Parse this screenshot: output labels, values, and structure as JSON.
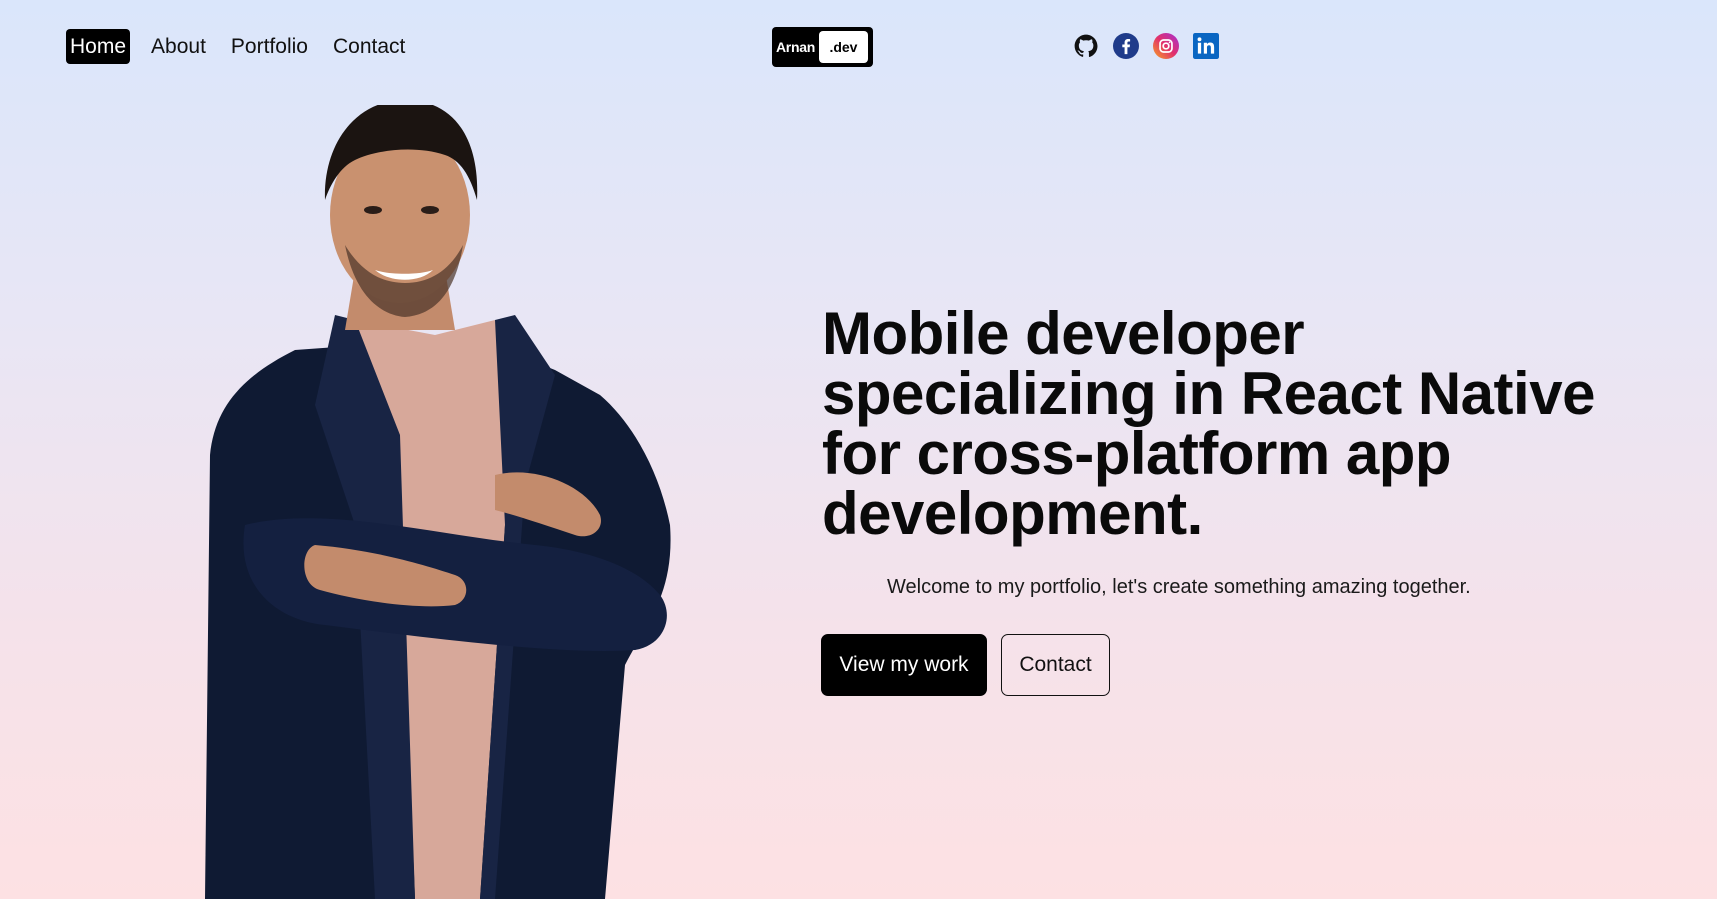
{
  "nav": {
    "items": [
      {
        "label": "Home",
        "active": true
      },
      {
        "label": "About",
        "active": false
      },
      {
        "label": "Portfolio",
        "active": false
      },
      {
        "label": "Contact",
        "active": false
      }
    ]
  },
  "logo": {
    "part1": "Arnan",
    "part2": ".dev"
  },
  "social": {
    "icons": [
      "github-icon",
      "facebook-icon",
      "instagram-icon",
      "linkedin-icon"
    ],
    "colors": {
      "github": "#111111",
      "facebook": "#1f3b8a",
      "instagram": "#d629c5",
      "linkedin": "#0a66c2"
    }
  },
  "hero": {
    "headline": "Mobile developer specializing in React Native for cross-platform app development.",
    "subtitle": "Welcome to my portfolio, let's create something amazing together.",
    "primary_button": "View my work",
    "secondary_button": "Contact"
  },
  "colors": {
    "bg_top": "#dae6fb",
    "bg_bottom": "#fde1e3",
    "accent": "#000000"
  }
}
